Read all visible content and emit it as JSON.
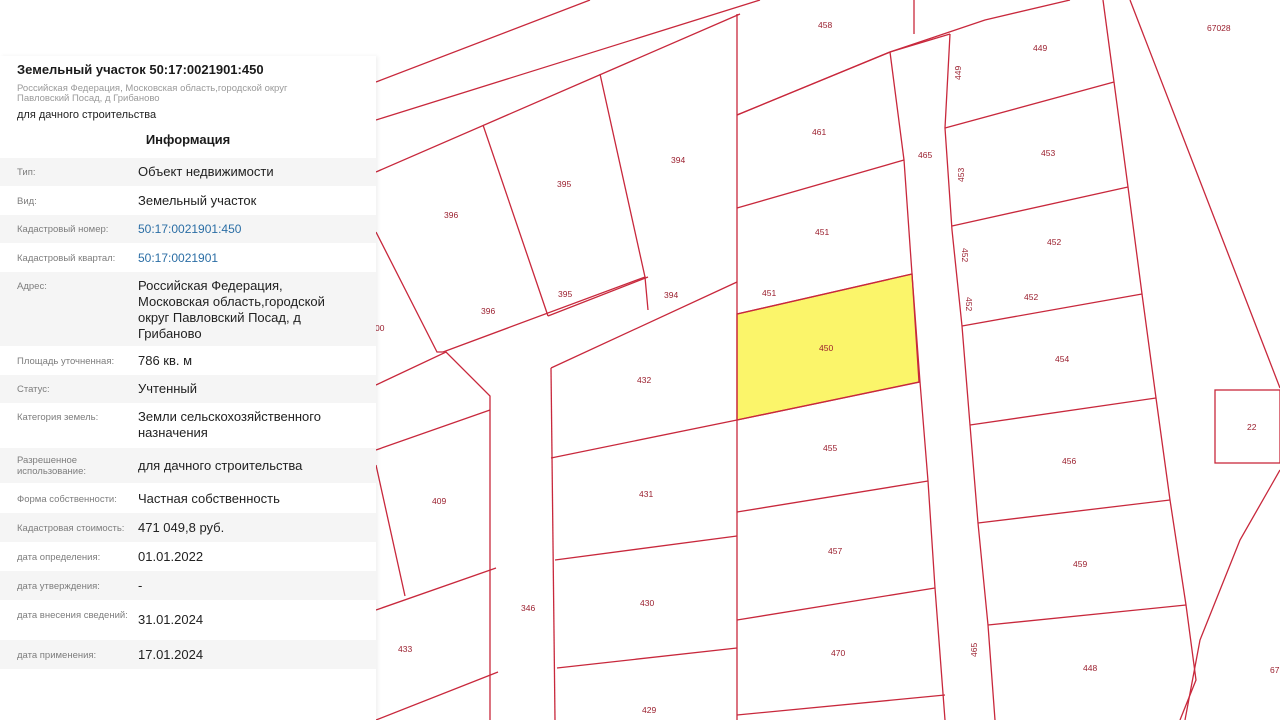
{
  "panel": {
    "title": "Земельный участок 50:17:0021901:450",
    "address_line1": "Российская Федерация, Московская область,городской округ",
    "address_line2": "Павловский Посад, д Грибаново",
    "usage": "для дачного строительства",
    "section_title": "Информация",
    "rows": [
      {
        "label": "Тип:",
        "value": "Объект недвижимости"
      },
      {
        "label": "Вид:",
        "value": "Земельный участок"
      },
      {
        "label": "Кадастровый номер:",
        "value": "50:17:0021901:450"
      },
      {
        "label": "Кадастровый квартал:",
        "value": "50:17:0021901"
      },
      {
        "label": "Адрес:",
        "value": "Российская Федерация, Московская область,городской округ Павловский Посад, д Грибаново"
      },
      {
        "label": "Площадь уточненная:",
        "value": "786 кв. м"
      },
      {
        "label": "Статус:",
        "value": "Учтенный"
      },
      {
        "label": "Категория земель:",
        "value": "Земли сельскохозяйственного назначения"
      },
      {
        "label": "Разрешенное использование:",
        "value": "для дачного строительства"
      },
      {
        "label": "Форма собственности:",
        "value": "Частная собственность"
      },
      {
        "label": "Кадастровая стоимость:",
        "value": "471 049,8 руб."
      },
      {
        "label": "дата определения:",
        "value": "01.01.2022"
      },
      {
        "label": "дата утверждения:",
        "value": "-"
      },
      {
        "label": "дата внесения сведений:",
        "value": "31.01.2024"
      },
      {
        "label": "дата применения:",
        "value": "17.01.2024"
      }
    ]
  },
  "map": {
    "selected_fill": "#fbf56a",
    "boundary_color": "#c8283c",
    "plot_labels": {
      "p458": "458",
      "p67028": "67028",
      "p449a": "449",
      "p449b": "449",
      "p461": "461",
      "p465a": "465",
      "p453a": "453",
      "p453b": "453",
      "p396a": "396",
      "p395a": "395",
      "p394a": "394",
      "p451a": "451",
      "p452a": "452",
      "p452b": "452",
      "p452c": "452",
      "p452d": "452",
      "p396b": "396",
      "p395b": "395",
      "p394b": "394",
      "p451b": "451",
      "p450": "450",
      "p454": "454",
      "p432": "432",
      "p22": "22",
      "p455": "455",
      "p456": "456",
      "p409": "409",
      "p431": "431",
      "p457": "457",
      "p459": "459",
      "p346": "346",
      "p430": "430",
      "p433": "433",
      "p470": "470",
      "p465b": "465",
      "p448": "448",
      "p429": "429",
      "p400": "00",
      "p67": "67"
    }
  }
}
